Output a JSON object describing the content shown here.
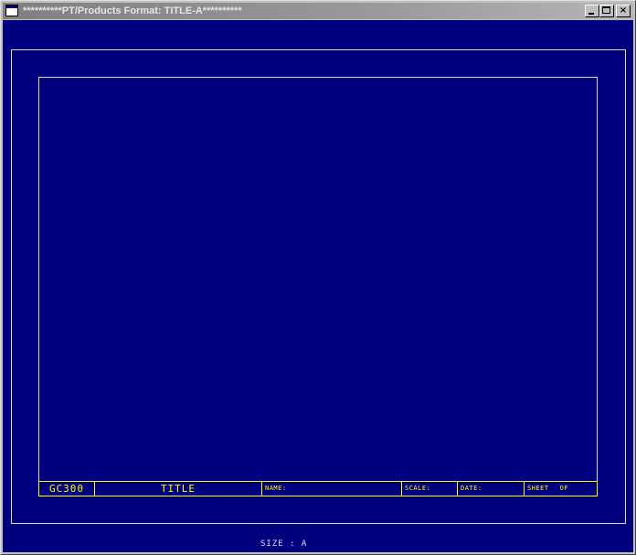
{
  "window": {
    "title": "**********PT/Products Format: TITLE-A**********",
    "controls": {
      "minimize": "minimize",
      "maximize": "maximize",
      "close": "×"
    }
  },
  "colors": {
    "canvas": "#00007f",
    "border_lines": "#d8d8d8",
    "title_block": "#ffff00",
    "titlebar": "#808080"
  },
  "title_block": {
    "drawing_number": "GC300",
    "title": "TITLE",
    "name_label": "NAME:",
    "scale_label": "SCALE:",
    "date_label": "DATE:",
    "sheet_label": "SHEET",
    "of_label": "OF"
  },
  "footer": {
    "size_text": "SIZE : A"
  }
}
